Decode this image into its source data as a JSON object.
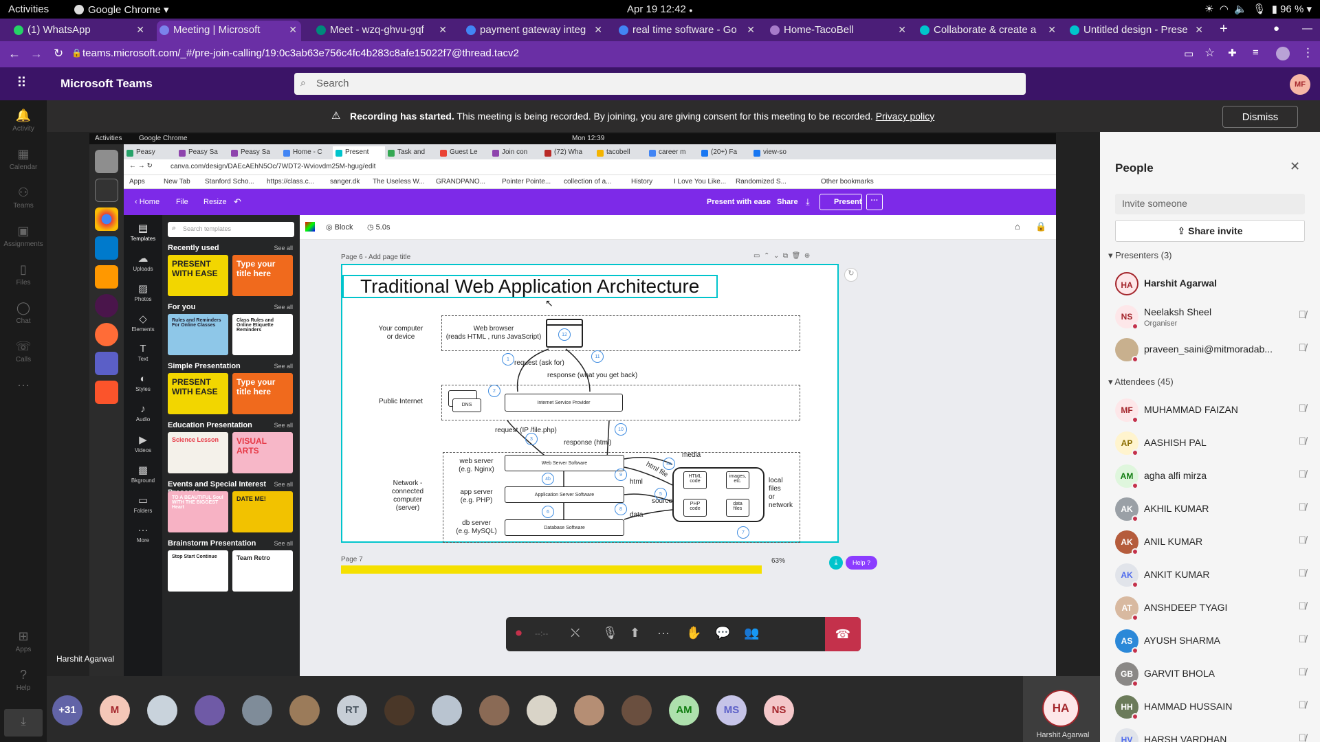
{
  "gnome": {
    "activities": "Activities",
    "app": "Google Chrome",
    "clock": "Apr 19  12:42",
    "battery": "96 %"
  },
  "tabs": [
    {
      "label": "(1) WhatsApp",
      "color": "#25d366"
    },
    {
      "label": "Meeting | Microsoft",
      "color": "#7b83eb"
    },
    {
      "label": "Meet - wzq-ghvu-gqf",
      "color": "#00897b"
    },
    {
      "label": "payment gateway integ",
      "color": "#4285f4"
    },
    {
      "label": "real time software - Go",
      "color": "#4285f4"
    },
    {
      "label": "Home-TacoBell",
      "color": "#a77bca"
    },
    {
      "label": "Collaborate & create a",
      "color": "#00c4cc"
    },
    {
      "label": "Untitled design - Prese",
      "color": "#00c4cc"
    }
  ],
  "address": {
    "url": "teams.microsoft.com/_#/pre-join-calling/19:0c3ab63e756c4fc4b283c8afe15022f7@thread.tacv2"
  },
  "teams": {
    "app_name": "Microsoft Teams",
    "search_placeholder": "Search",
    "avatar": "MF"
  },
  "banner": {
    "bold": "Recording has started.",
    "text": "This meeting is being recorded. By joining, you are giving consent for this meeting to be recorded.",
    "link": "Privacy policy",
    "dismiss": "Dismiss"
  },
  "rail": [
    {
      "label": "Activity",
      "icon": "bell-icon"
    },
    {
      "label": "Calendar",
      "icon": "calendar-icon"
    },
    {
      "label": "Teams",
      "icon": "teams-icon"
    },
    {
      "label": "Assignments",
      "icon": "assignments-icon"
    },
    {
      "label": "Files",
      "icon": "file-icon"
    },
    {
      "label": "Chat",
      "icon": "chat-icon"
    },
    {
      "label": "Calls",
      "icon": "phone-icon"
    },
    {
      "label": "Apps",
      "icon": "apps-icon"
    },
    {
      "label": "Help",
      "icon": "help-icon"
    }
  ],
  "shared": {
    "ubuntu": {
      "activities": "Activities",
      "app": "Google Chrome",
      "clock": "Mon 12:39"
    },
    "tabs": [
      "Peasy",
      "Peasy Sa",
      "Peasy Sa",
      "Home - C",
      "Present",
      "Task and",
      "Guest Le",
      "Join con",
      "(72) Wha",
      "tacobell",
      "career m",
      "(20+) Fa",
      "view-so"
    ],
    "url": "canva.com/design/DAEcAEhN5Oc/7WDT2-Wviovdm25M-hgug/edit",
    "bookmarks": [
      "Apps",
      "New Tab",
      "Stanford Scho...",
      "https://class.c...",
      "sanger.dk",
      "The Useless W...",
      "GRANDPANO...",
      "Pointer Pointe...",
      "collection of a...",
      "History",
      "I Love You Like...",
      "Randomized S...",
      "Other bookmarks"
    ],
    "canva_bar": {
      "home": "Home",
      "file": "File",
      "resize": "Resize",
      "present_ease": "Present with ease",
      "share": "Share",
      "present": "Present"
    },
    "rail": [
      "Templates",
      "Uploads",
      "Photos",
      "Elements",
      "Text",
      "Styles",
      "Audio",
      "Videos",
      "Bkground",
      "Folders",
      "More"
    ],
    "search_placeholder": "Search templates",
    "sections": [
      {
        "title": "Recently used",
        "see": "See all",
        "t1": "PRESENT WITH EASE",
        "t2": "Type your title here"
      },
      {
        "title": "For you",
        "see": "See all",
        "t1": "Rules and Reminders For Online Classes",
        "t2": "Class Rules and Online Etiquette Reminders"
      },
      {
        "title": "Simple Presentation",
        "see": "See all",
        "t1": "PRESENT WITH EASE",
        "t2": "Type your title here"
      },
      {
        "title": "Education Presentation",
        "see": "See all",
        "t1": "Science Lesson",
        "t2": "VISUAL ARTS"
      },
      {
        "title": "Events and Special Interest Presenta...",
        "see": "See all",
        "t1": "TO A BEAUTIFUL Soul WITH THE BIGGEST Heart",
        "t2": "DATE ME!"
      },
      {
        "title": "Brainstorm Presentation",
        "see": "See all",
        "t1": "Stop Start Continue",
        "t2": "Team Retro"
      }
    ],
    "toolbar": {
      "animation": "Block",
      "duration": "5.0s"
    },
    "page_label": "Page 6 - Add page title",
    "page7": "Page 7",
    "zoom": "63%",
    "help": "Help  ?",
    "slide": {
      "title": "Traditional Web Application Architecture",
      "left_labels": [
        "Your computer\nor device",
        "Public Internet",
        "Network -\nconnected\ncomputer\n(server)"
      ],
      "browser": "Web browser\n(reads HTML , runs JavaScript)",
      "request1": "request (ask for)",
      "response1": "response (what you get back)",
      "isp": "Internet Service Provider",
      "dns": "DNS",
      "request2": "request (IP /file.php)",
      "response2": "response (html)",
      "webserver": "web server\n(e.g. Nginx)",
      "appserver": "app server\n(e.g. PHP)",
      "dbserver": "db server\n(e.g. MySQL)",
      "ws_soft": "Web Server Software",
      "as_soft": "Application Server Software",
      "db_soft": "Database Software",
      "media": "media",
      "htmlfile": "html file",
      "html": "html",
      "source": "source",
      "data": "data",
      "html_code": "HTML\ncode",
      "images": "images,\netc.",
      "php_code": "PHP\ncode",
      "data_files": "data\nfiles",
      "local": "local\nfiles\nor\nnetwork",
      "nums": [
        "12",
        "1",
        "11",
        "2",
        "3",
        "10",
        "4a",
        "4b",
        "9",
        "5",
        "6",
        "8",
        "7"
      ]
    },
    "presenter": "Harshit Agarwal"
  },
  "people": {
    "title": "People",
    "invite_placeholder": "Invite someone",
    "share_invite": "Share invite",
    "presenters_header": "Presenters (3)",
    "attendees_header": "Attendees (45)",
    "presenters": [
      {
        "initials": "HA",
        "name": "Harshit Agarwal",
        "sub": "",
        "bg": "#fde7e9",
        "fg": "#a4262c",
        "ring": true
      },
      {
        "initials": "NS",
        "name": "Neelaksh Sheel",
        "sub": "Organiser",
        "bg": "#fde7e9",
        "fg": "#a4262c"
      },
      {
        "initials": "P",
        "name": "praveen_saini@mitmoradab...",
        "sub": "",
        "bg": "#c8b08e",
        "fg": "#fff"
      }
    ],
    "attendees": [
      {
        "initials": "MF",
        "name": "MUHAMMAD FAIZAN",
        "bg": "#fde7e9",
        "fg": "#a4262c"
      },
      {
        "initials": "AP",
        "name": "AASHISH PAL",
        "bg": "#fff4ce",
        "fg": "#8a6d00"
      },
      {
        "initials": "AM",
        "name": "agha alfi mirza",
        "bg": "#dff6dd",
        "fg": "#107c10"
      },
      {
        "initials": "AK",
        "name": "AKHIL KUMAR",
        "bg": "#9aa0a6",
        "fg": "#fff"
      },
      {
        "initials": "AK",
        "name": "ANIL KUMAR",
        "bg": "#b55c3c",
        "fg": "#fff"
      },
      {
        "initials": "AK",
        "name": "ANKIT KUMAR",
        "bg": "#e1e4ea",
        "fg": "#4f6bed"
      },
      {
        "initials": "AT",
        "name": "ANSHDEEP TYAGI",
        "bg": "#d8b9a0",
        "fg": "#fff"
      },
      {
        "initials": "AS",
        "name": "AYUSH SHARMA",
        "bg": "#2b88d8",
        "fg": "#fff"
      },
      {
        "initials": "GB",
        "name": "GARVIT BHOLA",
        "bg": "#8a8886",
        "fg": "#fff"
      },
      {
        "initials": "HH",
        "name": "HAMMAD HUSSAIN",
        "bg": "#6b7b5a",
        "fg": "#fff"
      },
      {
        "initials": "HV",
        "name": "HARSH VARDHAN",
        "bg": "#e1e4ea",
        "fg": "#4f6bed"
      }
    ]
  },
  "gallery": {
    "items": [
      {
        "label": "+31",
        "bg": "#6264a7"
      },
      {
        "label": "M",
        "bg": "#f4c7b8",
        "fg": "#a4262c"
      },
      {
        "label": "",
        "bg": "#c9d3dc"
      },
      {
        "label": "",
        "bg": "#6f5aa6"
      },
      {
        "label": "",
        "bg": "#7f8c99"
      },
      {
        "label": "",
        "bg": "#9b7b5a"
      },
      {
        "label": "RT",
        "bg": "#c7ced6",
        "fg": "#4a5560"
      },
      {
        "label": "",
        "bg": "#4a3728"
      },
      {
        "label": "",
        "bg": "#b9c4d0"
      },
      {
        "label": "",
        "bg": "#8a6a55"
      },
      {
        "label": "",
        "bg": "#d9d4c8"
      },
      {
        "label": "",
        "bg": "#b58e74"
      },
      {
        "label": "",
        "bg": "#6a4f3f"
      },
      {
        "label": "AM",
        "bg": "#aee0ad",
        "fg": "#107c10"
      },
      {
        "label": "MS",
        "bg": "#c6c4e8",
        "fg": "#5b5fc7"
      },
      {
        "label": "NS",
        "bg": "#f4c7c9",
        "fg": "#a4262c"
      }
    ],
    "self_initials": "HA",
    "self_name": "Harshit Agarwal"
  }
}
